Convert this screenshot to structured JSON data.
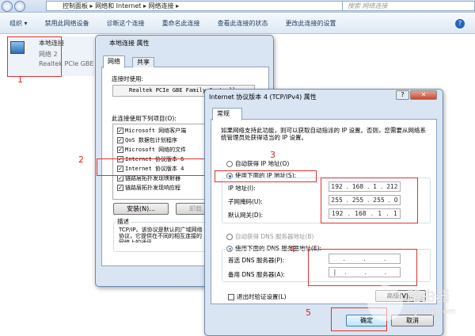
{
  "explorer": {
    "breadcrumbs": [
      "控制面板",
      "网络和 Internet",
      "网络连接"
    ],
    "search_placeholder": "搜索 网络连接",
    "toolbar": [
      "组织 ▾",
      "禁用此网络设备",
      "诊断这个连接",
      "重命名此连接",
      "查看此连接的状态",
      "更改此连接的设置"
    ],
    "connection": {
      "name": "本地连接",
      "network": "网络 2",
      "adapter": "Realtek PCIe GBE"
    }
  },
  "props_dialog": {
    "title": "本地连接 属性",
    "tabs": [
      "网络",
      "共享"
    ],
    "connect_using_label": "连接时使用:",
    "adapter": "Realtek PCIe GBE Family Controller",
    "items_label": "此连接使用下列项目(O):",
    "items": [
      "Microsoft 网络客户端",
      "QoS 数据包计划程序",
      "Microsoft 网络的文件",
      "Internet 协议版本 6",
      "Internet 协议版本 4",
      "链路层拓扑发现映射器",
      "链路层拓扑发现响应程"
    ],
    "install_label": "安装(N)...",
    "uninstall_label": "卸载",
    "desc_label": "描述",
    "desc_text": "TCP/IP。该协议是默认的广域网络协议，它提供在不同的相互连接的网络上的通讯。"
  },
  "ipv4_dialog": {
    "title": "Internet 协议版本 4 (TCP/IPv4) 属性",
    "tab": "常规",
    "intro": "如果网络支持此功能，则可以获取自动指派的 IP 设置。否则，您需要从网络系统管理员处获得适当的 IP 设置。",
    "auto_ip": "自动获得 IP 地址(O)",
    "manual_ip": "使用下面的 IP 地址(S):",
    "ip_label": "IP 地址(I):",
    "ip": [
      "192",
      "168",
      "1",
      "212"
    ],
    "mask_label": "子网掩码(U):",
    "mask": [
      "255",
      "255",
      "255",
      "0"
    ],
    "gateway_label": "默认网关(D):",
    "gateway": [
      "192",
      "168",
      "1",
      "1"
    ],
    "auto_dns": "自动获得 DNS 服务器地址(B)",
    "manual_dns": "使用下面的 DNS 服务器地址(E):",
    "dns1_label": "首选 DNS 服务器(P):",
    "dns2_label": "备用 DNS 服务器(A):",
    "validate_label": "退出时验证设置(L)",
    "advanced_label": "高级(V)...",
    "ok_label": "确定",
    "cancel_label": "取消"
  },
  "annotations": [
    "1",
    "2",
    "3",
    "4",
    "5"
  ],
  "watermark": {
    "text": "路由器",
    "url": "luyouqi.com"
  }
}
